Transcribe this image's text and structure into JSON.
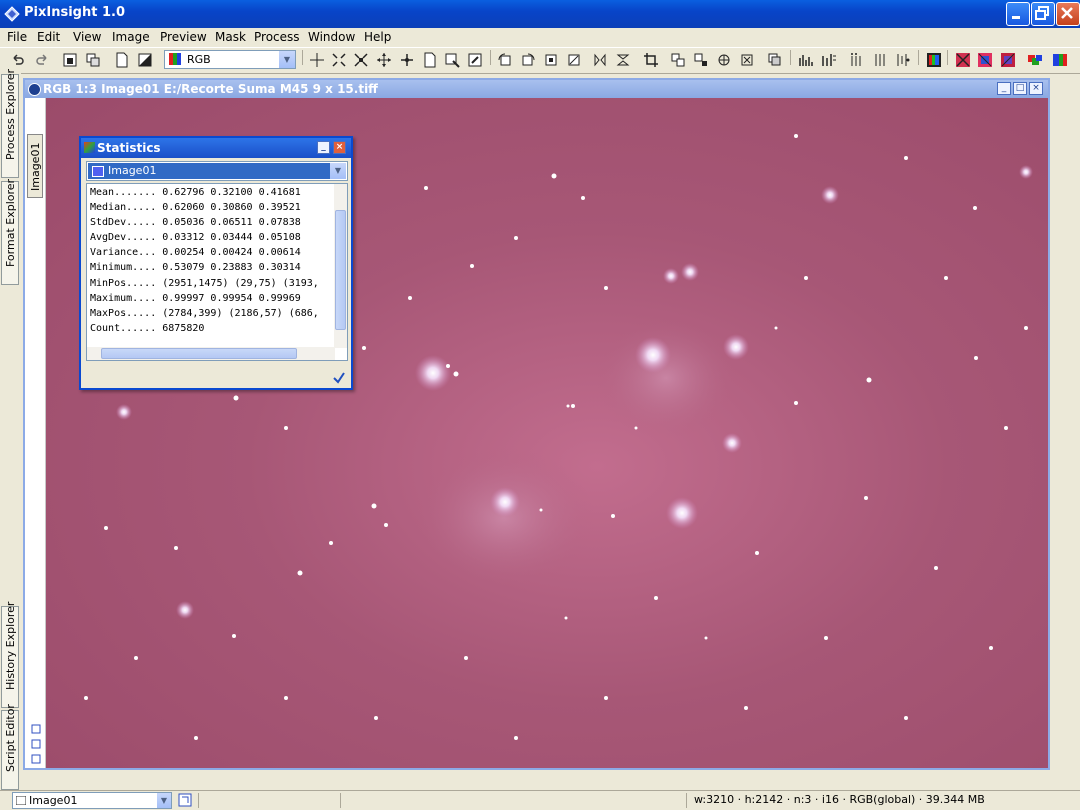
{
  "app": {
    "title": "PixInsight 1.0"
  },
  "menu": [
    "File",
    "Edit",
    "View",
    "Image",
    "Preview",
    "Mask",
    "Process",
    "Window",
    "Help"
  ],
  "toolbar": {
    "channel_select": "RGB"
  },
  "left_tabs": {
    "process_explorer": "Process Explorer",
    "format_explorer": "Format Explorer",
    "history_explorer": "History Explorer",
    "script_editor": "Script Editor"
  },
  "image_window": {
    "title": "RGB 1:3 Image01 E:/Recorte Suma M45 9 x 15.tiff",
    "side_tab": "Image01"
  },
  "statistics": {
    "title": "Statistics",
    "selected_view": "Image01",
    "rows": [
      {
        "label": "Mean.......",
        "values": "0.62796 0.32100 0.41681"
      },
      {
        "label": "Median.....",
        "values": "0.62060 0.30860 0.39521"
      },
      {
        "label": "StdDev.....",
        "values": "0.05036 0.06511 0.07838"
      },
      {
        "label": "AvgDev.....",
        "values": "0.03312 0.03444 0.05108"
      },
      {
        "label": "Variance...",
        "values": "0.00254 0.00424 0.00614"
      },
      {
        "label": "Minimum....",
        "values": "0.53079 0.23883 0.30314"
      },
      {
        "label": "MinPos.....",
        "values": "(2951,1475) (29,75) (3193,"
      },
      {
        "label": "Maximum....",
        "values": "0.99997 0.99954 0.99969"
      },
      {
        "label": "MaxPos.....",
        "values": "(2784,399) (2186,57) (686,"
      },
      {
        "label": "Count......",
        "values": "6875820"
      }
    ]
  },
  "statusbar": {
    "view": "Image01",
    "info": "w:3210 · h:2142 · n:3 · i16 · RGB(global) · 39.344 MB"
  },
  "colors": {
    "sky": "#a3536f",
    "titlebar": "#0a5fe0"
  }
}
